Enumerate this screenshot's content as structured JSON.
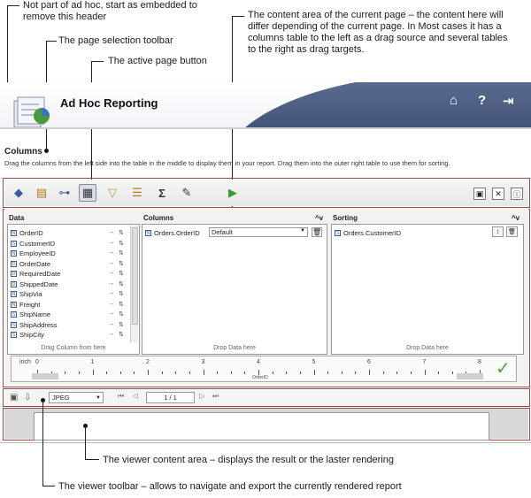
{
  "callouts": {
    "header_note": "Not part of ad hoc, start as embedded to remove this header",
    "toolbar_note": "The page selection toolbar",
    "active_note": "The active page button",
    "content_note": "The content area of the current page – the content here will differ depending of the current page. In Most cases it has a columns table to the left as a drag source and several tables to the right as drag targets.",
    "viewer_content_note": "The viewer content area – displays the result or the laster rendering",
    "viewer_toolbar_note": "The viewer toolbar – allows to navigate and export the currently rendered report"
  },
  "header": {
    "title": "Ad Hoc Reporting",
    "home_icon": "home-icon",
    "help_icon": "?",
    "exit_icon": "logout-icon"
  },
  "page": {
    "title": "Columns",
    "description": "Drag the columns from the left side into the table in the middle to display them in your report. Drag them into the outer right table to use them for sorting."
  },
  "data_panel": {
    "title": "Data",
    "fields": [
      {
        "label": "OrderID",
        "type": "N"
      },
      {
        "label": "CustomerID",
        "type": "S"
      },
      {
        "label": "EmployeeID",
        "type": "N"
      },
      {
        "label": "OrderDate",
        "type": "D"
      },
      {
        "label": "RequiredDate",
        "type": "D"
      },
      {
        "label": "ShippedDate",
        "type": "D"
      },
      {
        "label": "ShipVia",
        "type": "N"
      },
      {
        "label": "Freight",
        "type": "N"
      },
      {
        "label": "ShipName",
        "type": "S"
      },
      {
        "label": "ShipAddress",
        "type": "S"
      },
      {
        "label": "ShipCity",
        "type": "S"
      }
    ],
    "footer": "Drag Column from here"
  },
  "columns_panel": {
    "title": "Columns",
    "item": "Orders.OrderID",
    "format_value": "Default",
    "footer": "Drop Data here"
  },
  "sorting_panel": {
    "title": "Sorting",
    "item": "Orders.CustomerID",
    "footer": "Drop Data here"
  },
  "ruler": {
    "unit": "inch",
    "numbers": [
      "0",
      "1",
      "2",
      "3",
      "4",
      "5",
      "6",
      "7",
      "8"
    ],
    "column_label": "OrderID"
  },
  "viewer": {
    "format": "JPEG",
    "page_indicator": "1 / 1"
  }
}
